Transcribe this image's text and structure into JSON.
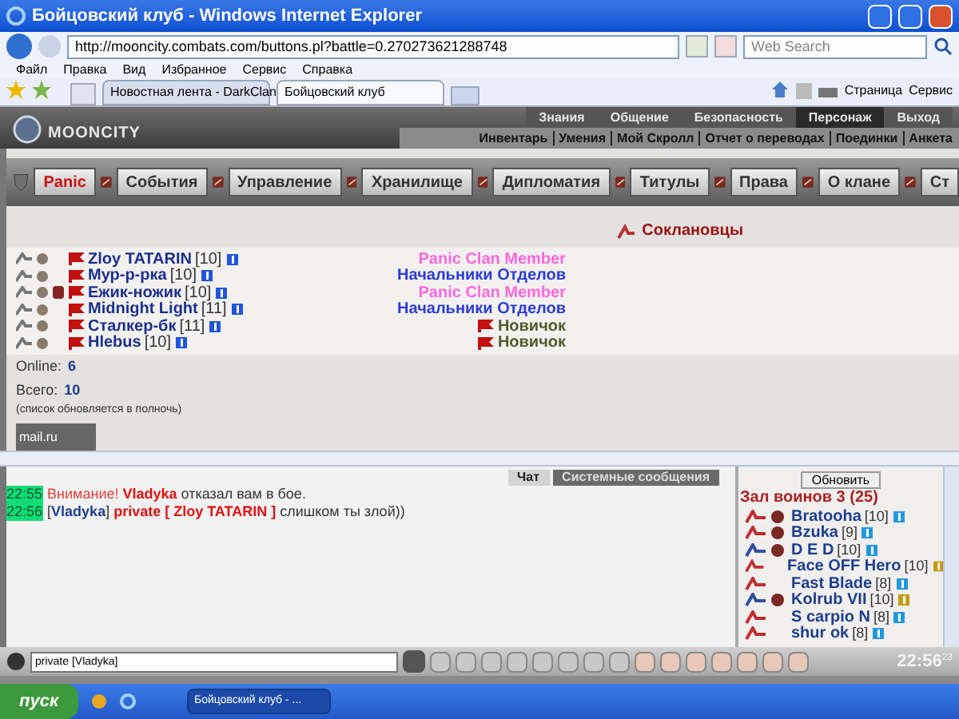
{
  "window": {
    "title": "Бойцовский клуб - Windows Internet Explorer"
  },
  "address_bar": {
    "url": "http://mooncity.combats.com/buttons.pl?battle=0.270273621288748"
  },
  "search": {
    "placeholder": "Web Search"
  },
  "menu": [
    "Файл",
    "Правка",
    "Вид",
    "Избранное",
    "Сервис",
    "Справка"
  ],
  "browser_tabs": [
    {
      "label": "Новостная лента - DarkClan",
      "selected": false
    },
    {
      "label": "Бойцовский клуб",
      "selected": true
    }
  ],
  "toolbar": [
    "Страница",
    "Сервис"
  ],
  "game": {
    "logo": "MOONCITY",
    "top_nav": [
      {
        "label": "Знания",
        "selected": false
      },
      {
        "label": "Общение",
        "selected": false
      },
      {
        "label": "Безопасность",
        "selected": false
      },
      {
        "label": "Персонаж",
        "selected": true
      },
      {
        "label": "Выход",
        "selected": false
      }
    ],
    "sub_nav": [
      "Инвентарь",
      "Умения",
      "Мой Скролл",
      "Отчет о переводах",
      "Поединки",
      "Анкета"
    ],
    "clan_tabs": [
      {
        "label": "Panic",
        "selected": true
      },
      {
        "label": "События",
        "selected": false
      },
      {
        "label": "Управление",
        "selected": false
      },
      {
        "label": "Хранилище",
        "selected": false
      },
      {
        "label": "Дипломатия",
        "selected": false
      },
      {
        "label": "Титулы",
        "selected": false
      },
      {
        "label": "Права",
        "selected": false
      },
      {
        "label": "О клане",
        "selected": false
      },
      {
        "label": "Ст",
        "selected": false
      }
    ],
    "heading": "Соклановцы",
    "members": [
      {
        "name": "Zloy TATARIN",
        "level": "[10]",
        "rank": "Panic Clan Member",
        "color": "#ff66dd",
        "extra_badge": false
      },
      {
        "name": "Мур-р-рка",
        "level": "[10]",
        "rank": "Начальники Отделов",
        "color": "#2a3bd6",
        "extra_badge": false
      },
      {
        "name": "Ежик-ножик",
        "level": "[10]",
        "rank": "Panic Clan Member",
        "color": "#ff66dd",
        "extra_badge": true
      },
      {
        "name": "Midnight Light",
        "level": "[11]",
        "rank": "Начальники Отделов",
        "color": "#2a3bd6",
        "extra_badge": false
      },
      {
        "name": "Сталкер-бк",
        "level": "[11]",
        "rank": "Новичок",
        "color": "#505a2a",
        "extra_badge": false
      },
      {
        "name": "Hlebus",
        "level": "[10]",
        "rank": "Новичок",
        "color": "#505a2a",
        "extra_badge": false
      }
    ],
    "online": {
      "label": "Online:",
      "value": "6"
    },
    "total": {
      "label": "Всего:",
      "value": "10"
    },
    "note": "(список обновляется в полночь)",
    "counter": "mail.ru"
  },
  "chat": {
    "tabs": [
      {
        "label": "Чат",
        "selected": true
      },
      {
        "label": "Системные сообщения",
        "selected": false
      }
    ],
    "messages": [
      {
        "time": "22:55",
        "parts": [
          {
            "kind": "alert",
            "text": "Внимание! "
          },
          {
            "kind": "nick",
            "text": "Vladyka"
          },
          {
            "kind": "plain",
            "text": " отказал вам в бое."
          }
        ]
      },
      {
        "time": "22:56",
        "parts": [
          {
            "kind": "plain",
            "text": "["
          },
          {
            "kind": "sender",
            "text": "Vladyka"
          },
          {
            "kind": "plain",
            "text": "] "
          },
          {
            "kind": "nick",
            "text": "private [ Zloy TATARIN ]"
          },
          {
            "kind": "plain",
            "text": " слишком ты злой))"
          }
        ]
      }
    ],
    "input": {
      "value": "private [Vladyka]"
    },
    "clock": {
      "time": "22:56",
      "seconds": "23"
    }
  },
  "room": {
    "refresh_button": "Обновить",
    "title": "Зал воинов 3 (25)",
    "players": [
      {
        "name": "Bratooha",
        "level": "[10]",
        "color": "#c03030",
        "emblem": true,
        "gold_badge": false
      },
      {
        "name": "Bzuka",
        "level": "[9]",
        "color": "#c03030",
        "emblem": true,
        "gold_badge": false
      },
      {
        "name": "D E D",
        "level": "[10]",
        "color": "#3050a0",
        "emblem": true,
        "gold_badge": false
      },
      {
        "name": "Face OFF Hero",
        "level": "[10]",
        "color": "#c03030",
        "emblem": false,
        "gold_badge": true
      },
      {
        "name": "Fast Blade",
        "level": "[8]",
        "color": "#c03030",
        "emblem": false,
        "gold_badge": false
      },
      {
        "name": "Kolrub VII",
        "level": "[10]",
        "color": "#3050a0",
        "emblem": true,
        "gold_badge": true
      },
      {
        "name": "S carpio N",
        "level": "[8]",
        "color": "#c03030",
        "emblem": false,
        "gold_badge": false
      },
      {
        "name": "shur ok",
        "level": "[8]",
        "color": "#c03030",
        "emblem": false,
        "gold_badge": false
      }
    ]
  },
  "taskbar": {
    "start": "пуск",
    "task": "Бойцовский клуб - ..."
  }
}
